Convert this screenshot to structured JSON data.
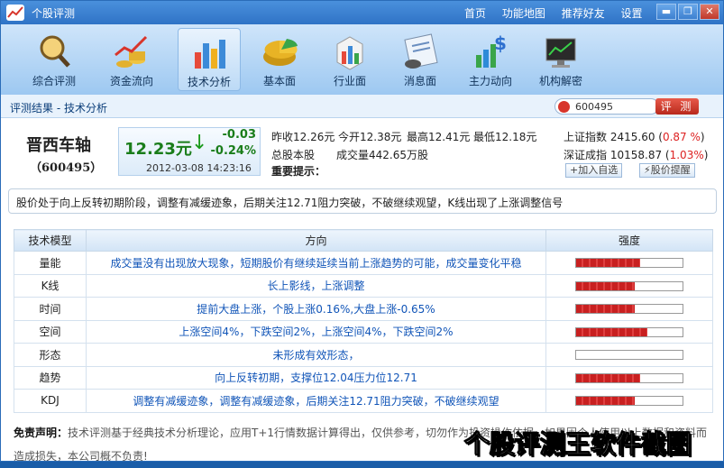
{
  "window": {
    "title": "个股评测",
    "nav": [
      "首页",
      "功能地图",
      "推荐好友",
      "设置"
    ],
    "buttons": [
      "▬",
      "❐",
      "✕"
    ]
  },
  "toolbar": {
    "items": [
      {
        "label": "综合评测",
        "icon": "magnifier-icon"
      },
      {
        "label": "资金流向",
        "icon": "coins-chart-icon"
      },
      {
        "label": "技术分析",
        "icon": "bar-chart-icon",
        "active": true
      },
      {
        "label": "基本面",
        "icon": "pie-chart-icon"
      },
      {
        "label": "行业面",
        "icon": "cube-chart-icon"
      },
      {
        "label": "消息面",
        "icon": "news-icon"
      },
      {
        "label": "主力动向",
        "icon": "dollar-chart-icon"
      },
      {
        "label": "机构解密",
        "icon": "monitor-icon"
      }
    ]
  },
  "crumb": "评测结果 - 技术分析",
  "search": {
    "value": "600495",
    "button": "评 测"
  },
  "stock": {
    "name": "晋西车轴",
    "code": "（600495）",
    "price": "12.23元",
    "change": "-0.03",
    "change_pct": "-0.24%",
    "datetime": "2012-03-08 14:23:16",
    "prev_close": "昨收12.26元",
    "open": "今开12.38元",
    "high": "最高12.41元",
    "low": "最低12.18元",
    "total_shares": "总股本股",
    "volume": "成交量442.65万股",
    "notice_label": "重要提示："
  },
  "indices": [
    {
      "name": "上证指数",
      "value": "2415.60",
      "pct": "0.87 %"
    },
    {
      "name": "深证成指",
      "value": "10158.87",
      "pct": "1.03%"
    }
  ],
  "actions": {
    "watch": "加入自选",
    "alert": "股价提醒"
  },
  "summary": "股价处于向上反转初期阶段，调整有减缓迹象，后期关注12.71阻力突破，不破继续观望，K线出现了上涨调整信号",
  "table": {
    "headers": [
      "技术模型",
      "方向",
      "强度"
    ],
    "rows": [
      {
        "model": "量能",
        "direction": "成交量没有出现放大现象，短期股价有继续延续当前上涨趋势的可能，成交量变化平稳",
        "strength": 0.6
      },
      {
        "model": "K线",
        "direction": "长上影线，上涨调整",
        "strength": 0.55
      },
      {
        "model": "时间",
        "direction": "提前大盘上涨，个股上涨0.16%,大盘上涨-0.65%",
        "strength": 0.55
      },
      {
        "model": "空间",
        "direction": "上涨空间4%，下跌空间2%，上涨空间4%，下跌空间2%",
        "strength": 0.67
      },
      {
        "model": "形态",
        "direction": "未形成有效形态，",
        "strength": 0.0
      },
      {
        "model": "趋势",
        "direction": "向上反转初期，支撑位12.04压力位12.71",
        "strength": 0.6
      },
      {
        "model": "KDJ",
        "direction": "调整有减缓迹象，调整有减缓迹象，后期关注12.71阻力突破，不破继续观望",
        "strength": 0.55
      }
    ]
  },
  "disclaimer": {
    "label": "免责声明：",
    "text": "技术评测基于经典技术分析理论，应用T+1行情数据计算得出，仅供参考，切勿作为投资操作依据，如果因个人使用以上数据和资料而造成损失，本公司概不负责!"
  },
  "watermark": "个股评测王软件截图"
}
